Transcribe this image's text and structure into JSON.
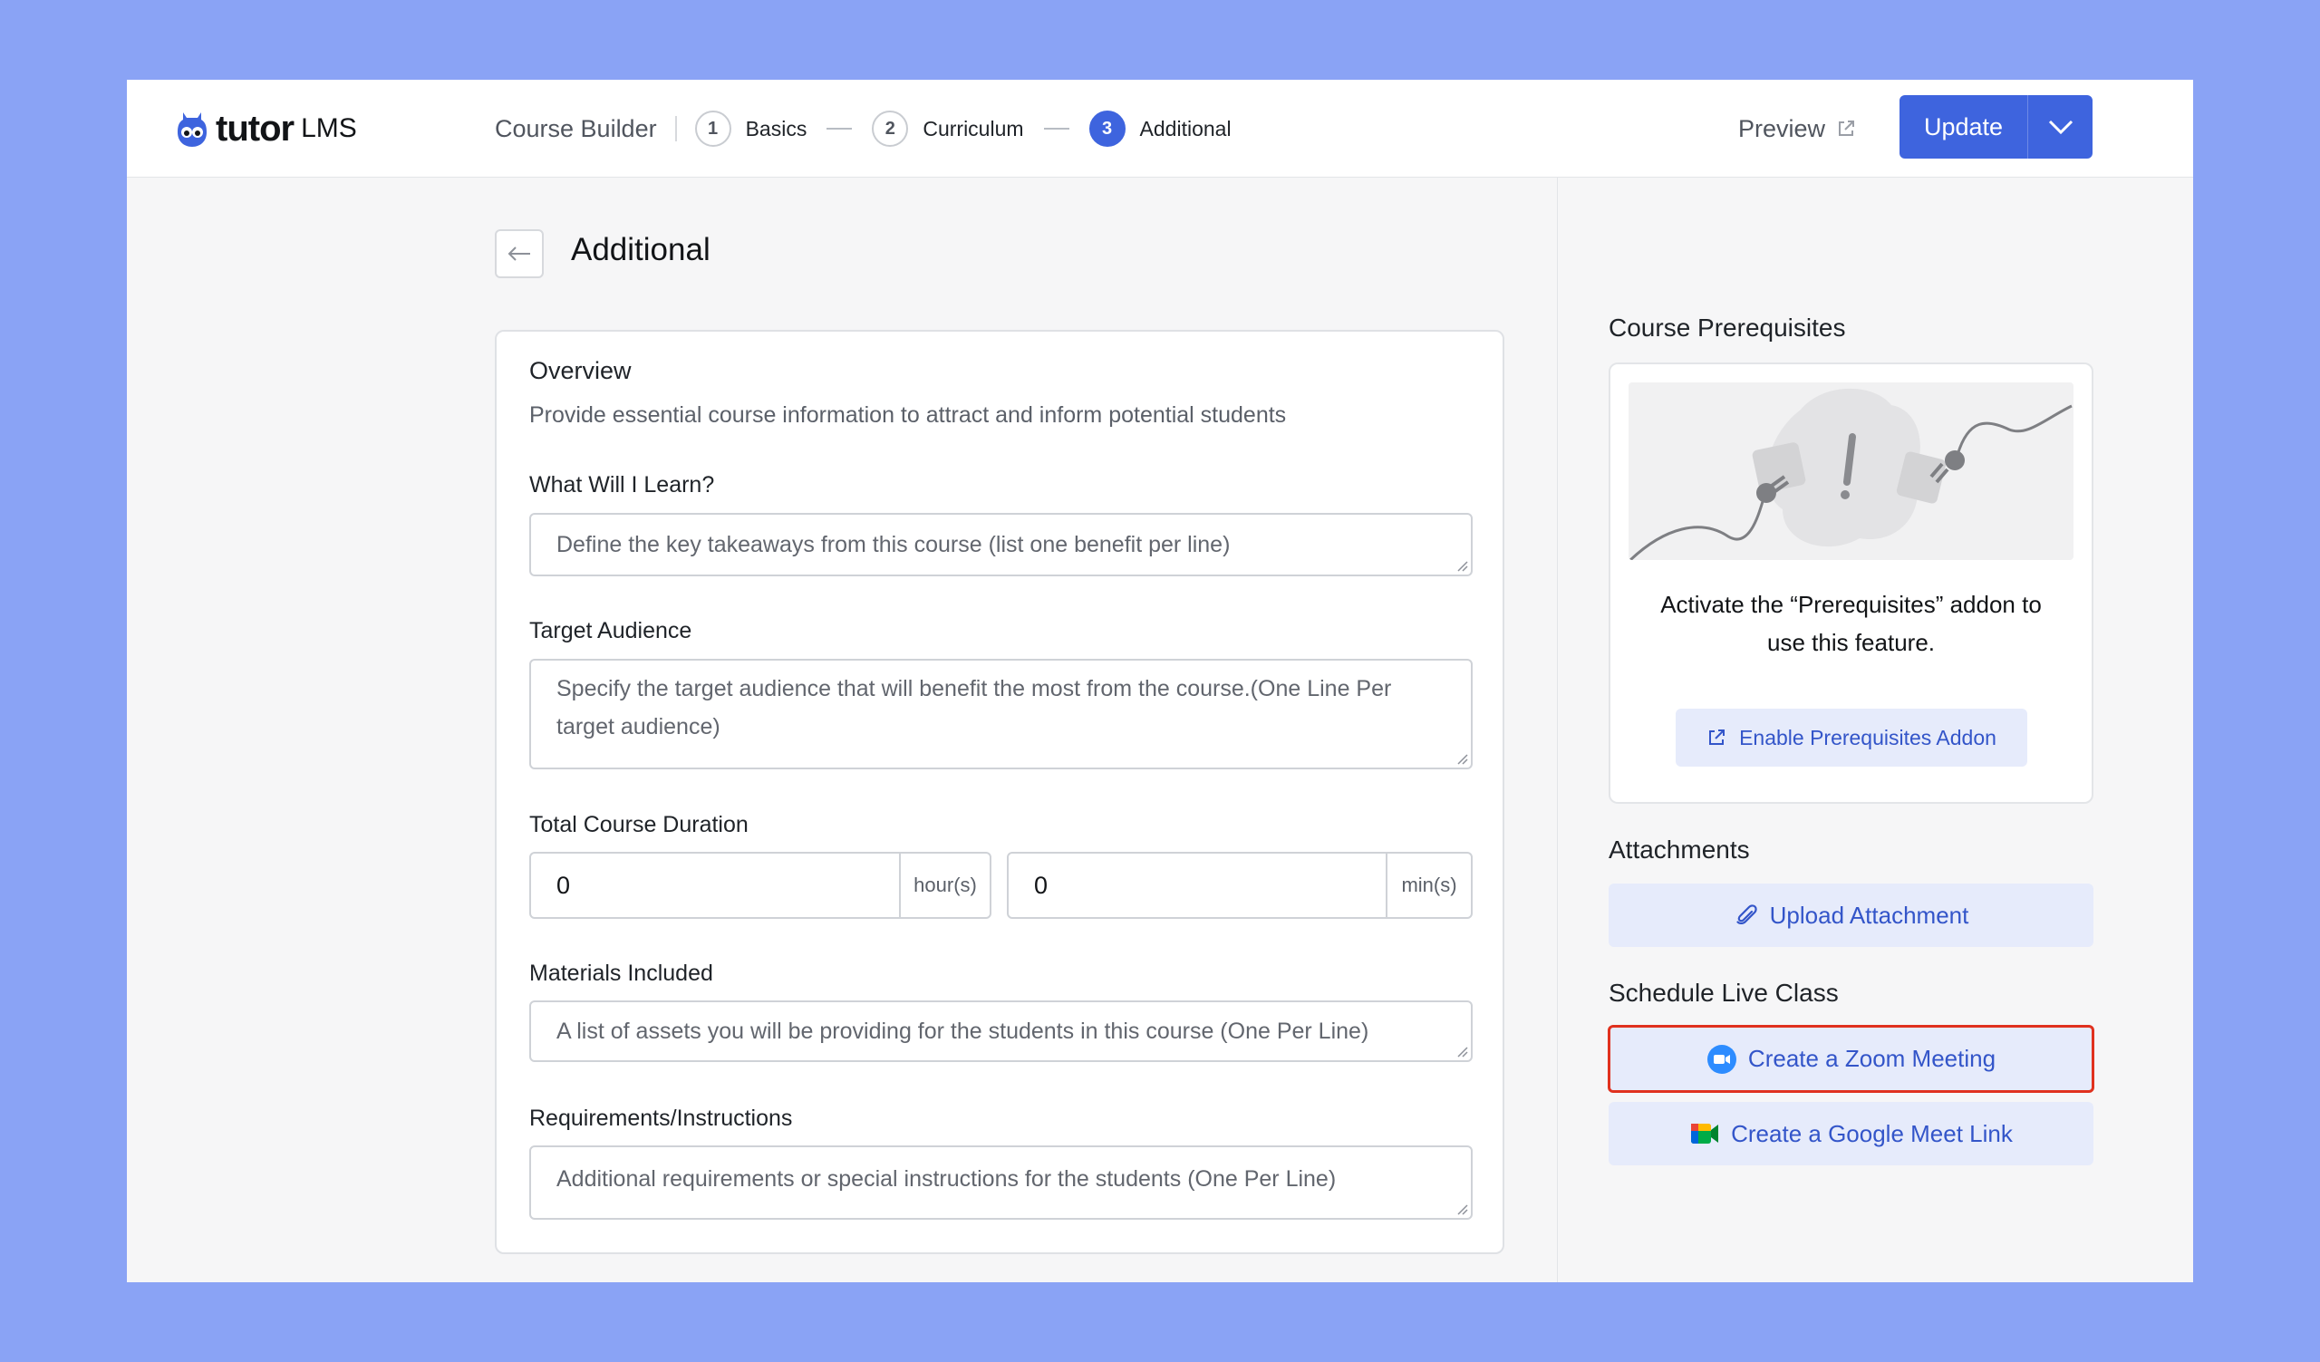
{
  "header": {
    "logo_word": "tutor",
    "logo_suffix": "LMS",
    "builder_label": "Course Builder",
    "steps": [
      {
        "num": "1",
        "label": "Basics"
      },
      {
        "num": "2",
        "label": "Curriculum"
      },
      {
        "num": "3",
        "label": "Additional",
        "active": true
      }
    ],
    "preview_label": "Preview",
    "update_label": "Update"
  },
  "main": {
    "title": "Additional",
    "overview": {
      "title": "Overview",
      "subtitle": "Provide essential course information to attract and inform potential students"
    },
    "fields": {
      "learn": {
        "label": "What Will I Learn?",
        "placeholder": "Define the key takeaways from this course (list one benefit per line)"
      },
      "audience": {
        "label": "Target Audience",
        "placeholder": "Specify the target audience that will benefit the most from the course.(One Line Per target audience)"
      },
      "duration": {
        "label": "Total Course Duration",
        "hours_value": "0",
        "hours_unit": "hour(s)",
        "mins_value": "0",
        "mins_unit": "min(s)"
      },
      "materials": {
        "label": "Materials Included",
        "placeholder": "A list of assets you will be providing for the students in this course (One Per Line)"
      },
      "requirements": {
        "label": "Requirements/Instructions",
        "placeholder": "Additional requirements or special instructions for the students (One Per Line)"
      }
    }
  },
  "sidebar": {
    "prereq_title": "Course Prerequisites",
    "prereq_message": "Activate the “Prerequisites” addon to use this feature.",
    "enable_label": "Enable Prerequisites Addon",
    "attachments_title": "Attachments",
    "upload_label": "Upload Attachment",
    "live_title": "Schedule Live Class",
    "zoom_label": "Create a Zoom Meeting",
    "meet_label": "Create a Google Meet Link"
  },
  "colors": {
    "accent": "#3e64de",
    "background": "#8aa3f5",
    "highlight_outline": "#e0311e"
  }
}
